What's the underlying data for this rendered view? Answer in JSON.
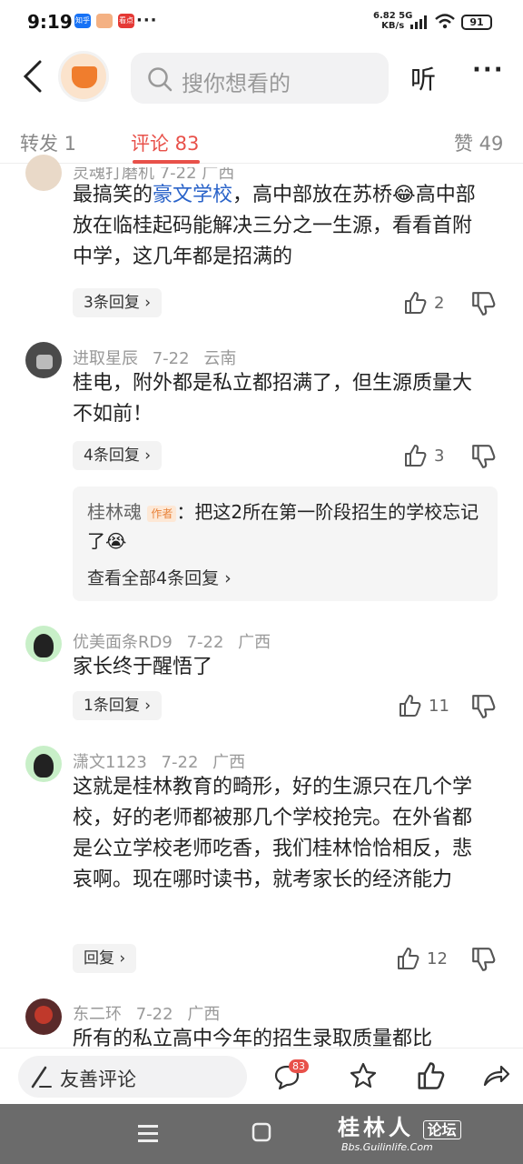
{
  "status_bar": {
    "time": "9:19",
    "speed_value": "6.82",
    "speed_unit": "KB/s",
    "network": "5G",
    "battery": "91",
    "notification_apps": [
      "知乎",
      "",
      "看点"
    ]
  },
  "header": {
    "search_placeholder": "搜你想看的",
    "listen_label": "听",
    "more_label": "···"
  },
  "tabs": {
    "repost": "转发 1",
    "comments": "评论 83",
    "likes": "赞 49"
  },
  "comments": [
    {
      "author_partial": "灵魂打磨机 7-22 广西",
      "text_before": "最搞笑的",
      "link": "豪文学校",
      "text_after": "，高中部放在苏桥😂高中部放在临桂起码能解决三分之一生源，看看首附中学，这几年都是招满的",
      "replies": "3条回复 ›",
      "likes": "2"
    },
    {
      "author": "进取星辰",
      "date": "7-22",
      "location": "云南",
      "text": "桂电，附外都是私立都招满了，但生源质量大不如前！",
      "replies": "4条回复 ›",
      "likes": "3",
      "sub_reply": {
        "author": "桂林魂",
        "tag": "作者",
        "text": "：把这2所在第一阶段招生的学校忘记了😭",
        "view_all": "查看全部4条回复 ›"
      }
    },
    {
      "author": "优美面条RD9",
      "date": "7-22",
      "location": "广西",
      "text": "家长终于醒悟了",
      "replies": "1条回复 ›",
      "likes": "11"
    },
    {
      "author": "潇文1123",
      "date": "7-22",
      "location": "广西",
      "text": "这就是桂林教育的畸形，好的生源只在几个学校，好的老师都被那几个学校抢完。在外省都是公立学校老师吃香，我们桂林恰恰相反，悲哀啊。现在哪时读书，就考家长的经济能力",
      "replies": "回复 ›",
      "likes": "12"
    },
    {
      "author": "东二环",
      "date": "7-22",
      "location": "广西",
      "text": "所有的私立高中今年的招生录取质量都比"
    }
  ],
  "bottom_bar": {
    "input_placeholder": "友善评论",
    "comment_count": "83"
  },
  "watermark": {
    "title": "桂林人",
    "badge": "论坛",
    "url": "Bbs.Guilinlife.Com"
  },
  "colors": {
    "accent": "#e8514a",
    "link": "#2a63c9"
  }
}
